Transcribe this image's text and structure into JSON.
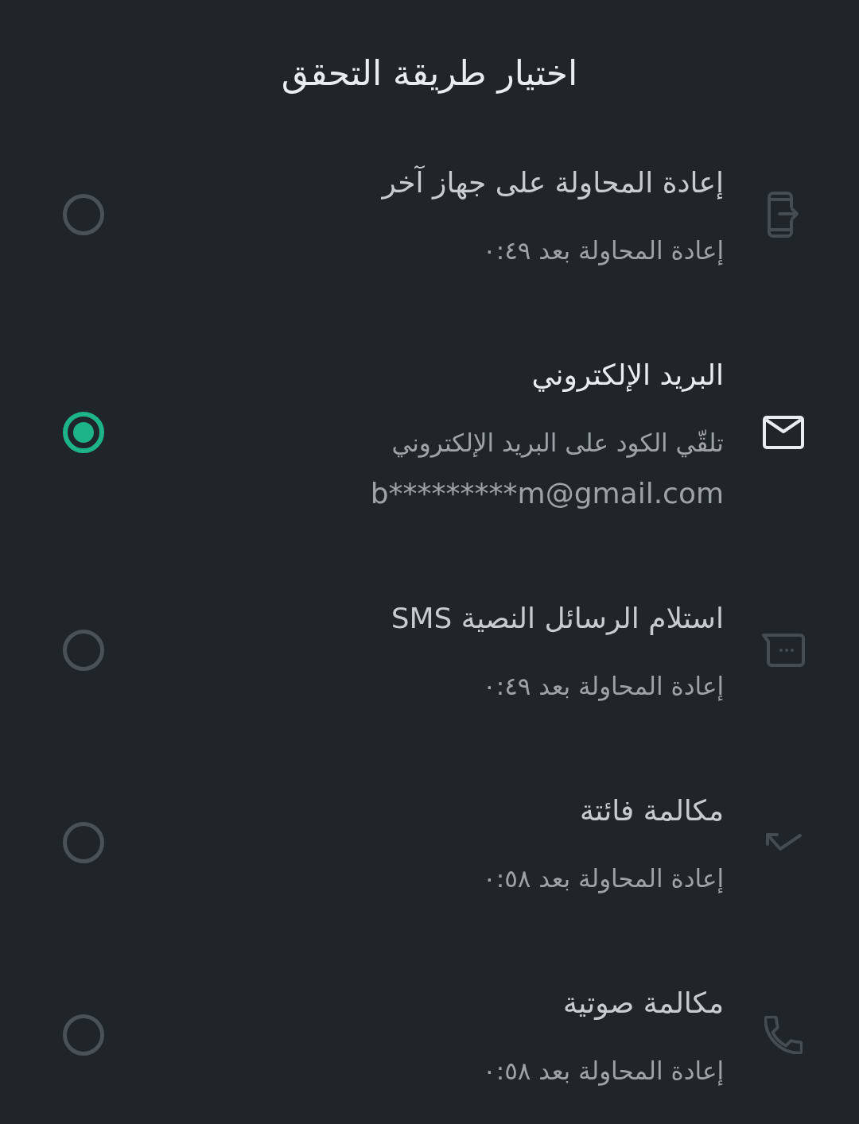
{
  "header": {
    "title": "اختيار طريقة التحقق"
  },
  "options": [
    {
      "kind": "device",
      "title": "إعادة المحاولة على جهاز آخر",
      "lines": [
        "إعادة المحاولة بعد ٠:٤٩"
      ],
      "disabled": true,
      "selected": false
    },
    {
      "kind": "email",
      "title": "البريد الإلكتروني",
      "lines": [
        "تلقّي الكود على البريد الإلكتروني",
        "b*********m@gmail.com"
      ],
      "disabled": false,
      "selected": true
    },
    {
      "kind": "sms",
      "title": "استلام الرسائل النصية SMS",
      "lines": [
        "إعادة المحاولة بعد ٠:٤٩"
      ],
      "disabled": true,
      "selected": false
    },
    {
      "kind": "missed_call",
      "title": "مكالمة فائتة",
      "lines": [
        "إعادة المحاولة بعد ٠:٥٨"
      ],
      "disabled": true,
      "selected": false
    },
    {
      "kind": "voice_call",
      "title": "مكالمة صوتية",
      "lines": [
        "إعادة المحاولة بعد ٠:٥٨"
      ],
      "disabled": true,
      "selected": false
    }
  ]
}
